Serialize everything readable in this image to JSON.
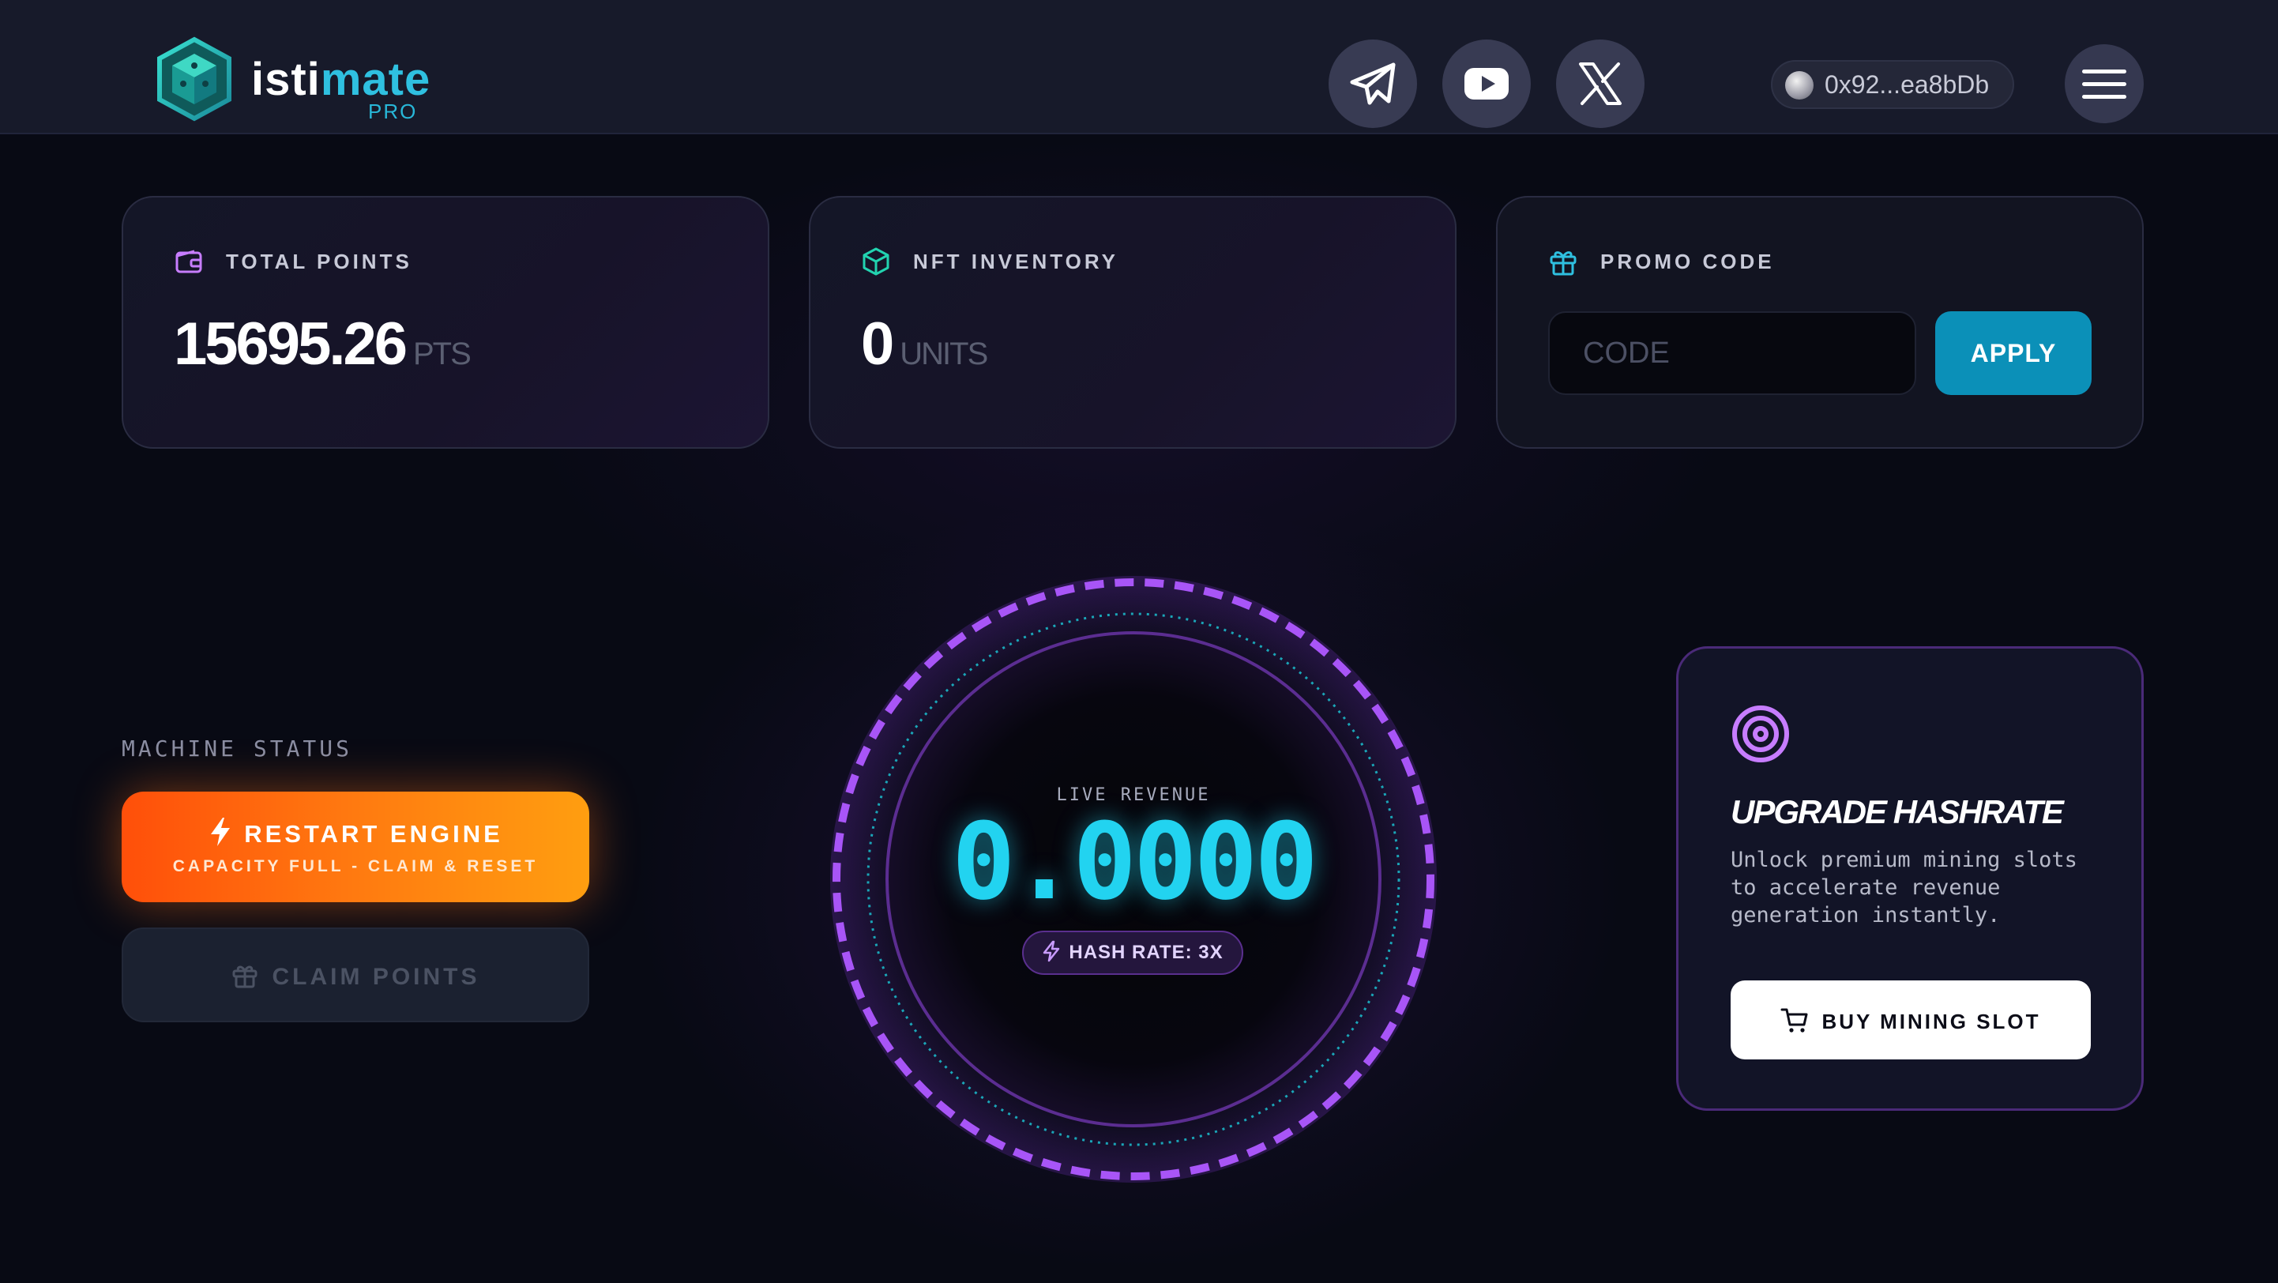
{
  "header": {
    "logo": {
      "word_start": "isti",
      "word_accent": "mate",
      "badge": "PRO",
      "icon": "cube-logo-icon"
    },
    "social": [
      {
        "name": "telegram",
        "icon": "telegram-icon"
      },
      {
        "name": "youtube",
        "icon": "youtube-icon"
      },
      {
        "name": "x",
        "icon": "x-icon"
      }
    ],
    "wallet": {
      "address": "0x92...ea8bDb"
    },
    "menu_icon": "hamburger-menu-icon"
  },
  "cards": {
    "total_points": {
      "label": "TOTAL POINTS",
      "value": "15695.26",
      "unit": "PTS",
      "icon": "wallet-icon"
    },
    "nft_inventory": {
      "label": "NFT INVENTORY",
      "value": "0",
      "unit": "UNITS",
      "icon": "cube-icon"
    },
    "promo_code": {
      "label": "PROMO CODE",
      "placeholder": "CODE",
      "value": "",
      "apply_label": "APPLY",
      "icon": "gift-icon"
    }
  },
  "machine": {
    "status_label": "MACHINE STATUS",
    "restart_title": "RESTART ENGINE",
    "restart_subtitle": "CAPACITY FULL - CLAIM & RESET",
    "claim_label": "CLAIM POINTS"
  },
  "gauge": {
    "title": "LIVE REVENUE",
    "value": "0.0000",
    "hash_rate": "HASH RATE: 3X"
  },
  "upgrade": {
    "title": "UPGRADE HASHRATE",
    "description": "Unlock premium mining slots to accelerate revenue generation instantly.",
    "buy_label": "BUY MINING SLOT",
    "icon": "target-icon"
  },
  "colors": {
    "accent_cyan": "#22d3f0",
    "accent_purple": "#a855f7",
    "accent_orange": "#ff7a10",
    "apply_blue": "#0b90b8"
  }
}
